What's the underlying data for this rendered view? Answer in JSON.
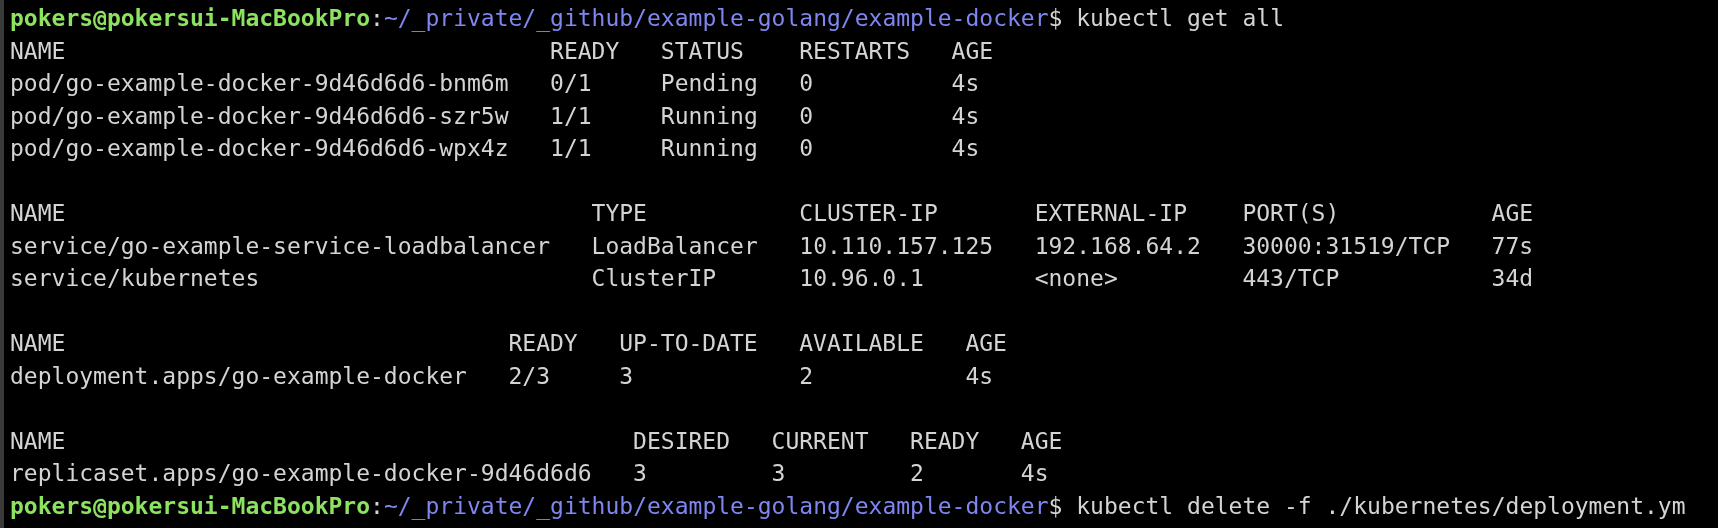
{
  "terminal": [
    {
      "kind": "prompt",
      "user_host": "pokers@pokersui-MacBookPro",
      "separator": ":",
      "path": "~/_private/_github/example-golang/example-docker",
      "symbol": "$",
      "command": "kubectl get all"
    },
    {
      "kind": "table",
      "columns": [
        "NAME",
        "READY",
        "STATUS",
        "RESTARTS",
        "AGE"
      ],
      "rows": [
        [
          "pod/go-example-docker-9d46d6d6-bnm6m",
          "0/1",
          "Pending",
          "0",
          "4s"
        ],
        [
          "pod/go-example-docker-9d46d6d6-szr5w",
          "1/1",
          "Running",
          "0",
          "4s"
        ],
        [
          "pod/go-example-docker-9d46d6d6-wpx4z",
          "1/1",
          "Running",
          "0",
          "4s"
        ]
      ]
    },
    {
      "kind": "table",
      "columns": [
        "NAME",
        "TYPE",
        "CLUSTER-IP",
        "EXTERNAL-IP",
        "PORT(S)",
        "AGE"
      ],
      "rows": [
        [
          "service/go-example-service-loadbalancer",
          "LoadBalancer",
          "10.110.157.125",
          "192.168.64.2",
          "30000:31519/TCP",
          "77s"
        ],
        [
          "service/kubernetes",
          "ClusterIP",
          "10.96.0.1",
          "<none>",
          "443/TCP",
          "34d"
        ]
      ]
    },
    {
      "kind": "table",
      "columns": [
        "NAME",
        "READY",
        "UP-TO-DATE",
        "AVAILABLE",
        "AGE"
      ],
      "rows": [
        [
          "deployment.apps/go-example-docker",
          "2/3",
          "3",
          "2",
          "4s"
        ]
      ]
    },
    {
      "kind": "table",
      "columns": [
        "NAME",
        "DESIRED",
        "CURRENT",
        "READY",
        "AGE"
      ],
      "rows": [
        [
          "replicaset.apps/go-example-docker-9d46d6d6",
          "3",
          "3",
          "2",
          "4s"
        ]
      ]
    },
    {
      "kind": "prompt",
      "user_host": "pokers@pokersui-MacBookPro",
      "separator": ":",
      "path": "~/_private/_github/example-golang/example-docker",
      "symbol": "$",
      "command": "kubectl delete -f ./kubernetes/deployment.ym"
    }
  ]
}
